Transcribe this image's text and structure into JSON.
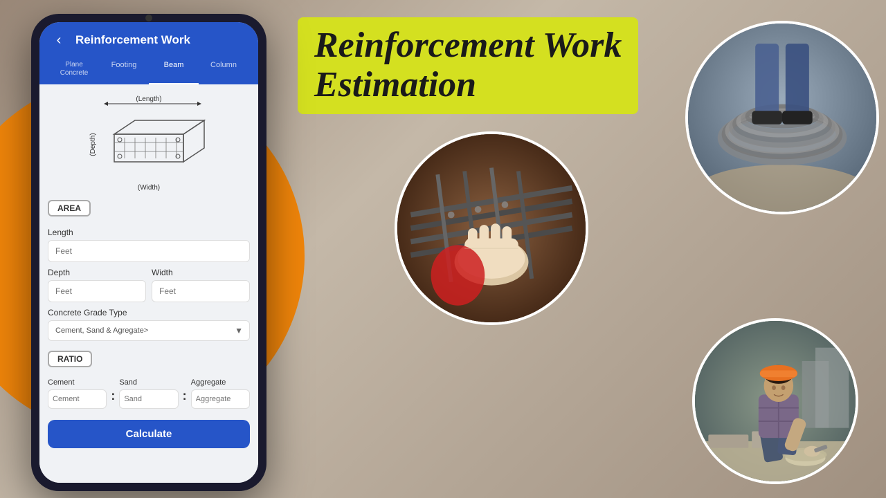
{
  "background": {
    "color": "#b0a090"
  },
  "phone": {
    "header": {
      "title": "Reinforcement Work",
      "back_label": "‹"
    },
    "tabs": [
      {
        "label": "Plane\nConcrete",
        "id": "plane",
        "active": false
      },
      {
        "label": "Footing",
        "id": "footing",
        "active": false
      },
      {
        "label": "Beam",
        "id": "beam",
        "active": true
      },
      {
        "label": "Column",
        "id": "column",
        "active": false
      }
    ],
    "area_section": {
      "badge": "AREA",
      "length_label": "Length",
      "length_placeholder": "Feet",
      "depth_label": "Depth",
      "depth_placeholder": "Feet",
      "width_label": "Width",
      "width_placeholder": "Feet",
      "grade_label": "Concrete Grade Type",
      "grade_placeholder": "Cement, Sand & Agregate>"
    },
    "ratio_section": {
      "badge": "RATIO",
      "cement_label": "Cement",
      "cement_placeholder": "Cement",
      "sand_label": "Sand",
      "sand_placeholder": "Sand",
      "aggregate_label": "Aggregate",
      "aggregate_placeholder": "Aggregate"
    },
    "calculate_button": "Calculate"
  },
  "right_section": {
    "title_line1": "Reinforcement Work",
    "title_line2": "Estimation",
    "circles": [
      {
        "id": "rebar-circle",
        "type": "rebar"
      },
      {
        "id": "wire-circle",
        "type": "wire"
      },
      {
        "id": "worker-circle",
        "type": "worker"
      }
    ]
  },
  "beam_diagram": {
    "length_label": "(Length)",
    "depth_label": "(Depth)",
    "width_label": "(Width)"
  }
}
